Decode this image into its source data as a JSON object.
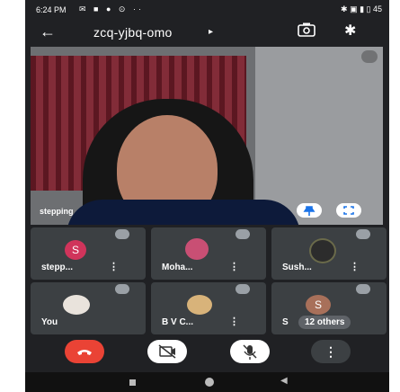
{
  "status_bar": {
    "time": "6:24 PM",
    "left_icons": "✉ ■ ● ⊙ ··",
    "right_icons": "✱ ▣ ▮ ▯ 45"
  },
  "header": {
    "meeting_code": "zcq-yjbq-omo",
    "title_arrow": "▸",
    "back_icon": "←",
    "bluetooth_icon": "✱"
  },
  "main_video": {
    "participant_name": "stepping"
  },
  "tiles": [
    {
      "name": "stepp...",
      "avatar_letter": "S",
      "avatar_color": "#d0345b",
      "more": "⋮"
    },
    {
      "name": "Moha...",
      "avatar_letter": "",
      "avatar_color": "#c94f74",
      "more": "⋮"
    },
    {
      "name": "Sush...",
      "avatar_letter": "",
      "avatar_color": "#2c2c2c",
      "more": "⋮"
    },
    {
      "name": "You",
      "avatar_letter": "",
      "avatar_color": "#e9e3dc",
      "more": ""
    },
    {
      "name": "B V C...",
      "avatar_letter": "",
      "avatar_color": "#d8b37a",
      "more": "⋮"
    },
    {
      "name": "S",
      "avatar_letter": "S",
      "avatar_color": "#a8705a",
      "more": "",
      "others": "12 others"
    }
  ],
  "controls": {
    "more_label": "⋮"
  },
  "colors": {
    "background": "#202124",
    "tile": "#3c4043",
    "end_call": "#ea4335"
  }
}
